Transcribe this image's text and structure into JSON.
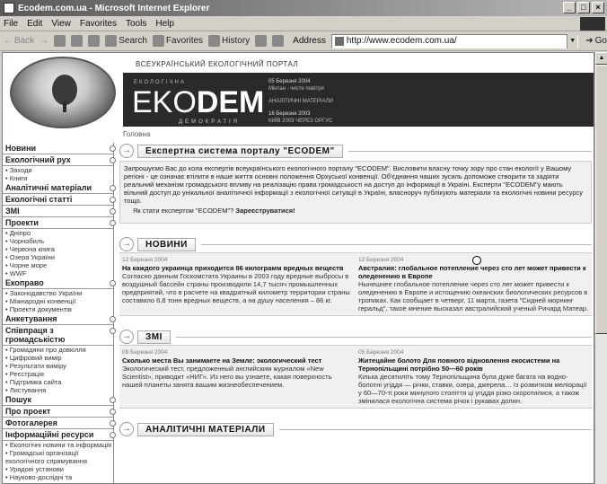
{
  "window": {
    "title": "Ecodem.com.ua - Microsoft Internet Explorer",
    "controls": [
      "_",
      "□",
      "×"
    ]
  },
  "menu": [
    "File",
    "Edit",
    "View",
    "Favorites",
    "Tools",
    "Help"
  ],
  "toolbar": {
    "back": "Back",
    "search": "Search",
    "favorites": "Favorites",
    "history": "History",
    "address_label": "Address",
    "address_value": "http://www.ecodem.com.ua/",
    "go": "Go"
  },
  "header": {
    "portal_title": "ВСЕУКРАЇНСЬКИЙ ЕКОЛОГІЧНИЙ ПОРТАЛ",
    "logo_small": "ЕКОЛОГІЧНА",
    "logo_main_light": "EKO",
    "logo_main_bold": "DEM",
    "logo_sub": "ДЕМОКРАТІЯ",
    "news1_date": "05 Березня 2004",
    "news1_text": "Мінтан - чисте повітря",
    "analytic": "АНАЛІТИЧНІ МАТЕРІАЛИ",
    "news2_date": "16 Березня 2003",
    "news2_text": "КИЇВ 2003 ЧЕРЕЗ ОРГУС"
  },
  "breadcrumb": "Головна",
  "sidebar": [
    {
      "title": "Новини",
      "items": []
    },
    {
      "title": "Екологічний рух",
      "items": [
        "Заходи",
        "Книги"
      ]
    },
    {
      "title": "Аналітичні матеріали",
      "items": []
    },
    {
      "title": "Екологічні статті",
      "items": []
    },
    {
      "title": "ЗМІ",
      "items": []
    },
    {
      "title": "Проекти",
      "items": [
        "Дніпро",
        "Чорнобиль",
        "Червона книга",
        "Озера України",
        "Чорне море",
        "WWF"
      ]
    },
    {
      "title": "Екоправо",
      "items": [
        "Законодавство України",
        "Міжнародні конвенції",
        "Проекти документів"
      ]
    },
    {
      "title": "Анкетування",
      "items": []
    },
    {
      "title": "Співпраця з громадськістю",
      "items": [
        "Громадяни про довкілля",
        "Цифровий вимір",
        "Результати виміру",
        "Реєстрація",
        "Підтримка сайта",
        "Листування"
      ]
    },
    {
      "title": "Пошук",
      "items": []
    },
    {
      "title": "Про проект",
      "items": []
    },
    {
      "title": "Фотогалерея",
      "items": []
    },
    {
      "title": "Інформаційні ресурси",
      "items": [
        "Екологічні новини та інформація",
        "Громадські організації екологічного спрямування",
        "Урядові установи",
        "Науково-дослідні та"
      ]
    }
  ],
  "expert": {
    "heading": "Експертна система порталу \"ECODEM\"",
    "body": "Запрошуємо Вас до кола експертів всеукраїнського екологічного порталу \"ECODEM\". Висловити власну точку зору про стан екології у Вашому регіоні - це означає втілити в наше життя основні положення Орхуської конвенції. Об'єднання наших зусиль допоможе створити та задіяти реальний механізм громадського впливу на реалізацію права громадськості на доступ до інформації в Україні. Експерти \"ECODEM\"у мають вільний доступ до унікальної аналітичної інформації з екологічної ситуації в Україні, власноруч публікують матеріали та екологічні новини ресурсу тощо.",
    "reg_prefix": "Як стати експертом \"ECODEM\"?",
    "reg_link": "Зареєструватися!"
  },
  "news": {
    "heading": "НОВИНИ",
    "left": {
      "date": "12 Березня 2004",
      "title": "На каждого украинца приходится 86 килограмм вредных веществ",
      "body": "Согласно данным Госкомстата Украины в 2003 году вредные выбросы в воздушный бассейн страны производили 14,7 тысяч промышленных предприятий, что в расчете на квадратный километр территории страны составило 6,8 тонн вредных веществ, а на душу населения – 86 кг."
    },
    "right": {
      "date": "12 Березня 2004",
      "title": "Австралия: глобальное потепление через сто лет может привести к оледенению в Европе",
      "body": "Нынешнее глобальное потепление через сто лет может привести к оледенению в Европе и истощению океанских биологических ресурсов в тропиках. Как сообщает в четверг, 11 марта, газета \"Сидней морнинг геральд\", такое мнение высказал австралийский ученый Ричард Матеар."
    }
  },
  "zmi": {
    "heading": "ЗМІ",
    "left": {
      "date": "09 Березня 2004",
      "title": "Сколько места Вы занимаете на Земле: экологический тест",
      "body": "Экологический тест, предложенный английским журналом «New Scientist», приводит «НИГ». Из него вы узнаете, какая поверхность нашей планеты занята вашим жизнеобеспечением."
    },
    "right": {
      "date": "05 Березня 2004",
      "title": "Житецайне болото Для повного відновлення екосистеми на Тернопільщині потрібно 50—60 років",
      "body": "Кілька десятиліть тому Тернопільщина була дуже багата на водно-болотні угіддя — річки, ставки, озера, джерела… Із розвитком меліорації у 60—70-ті роки минулого століття ці угіддя різко скоротилися, а також змінилася екологічна система річок і рукавах долин."
    }
  },
  "analytic": {
    "heading": "АНАЛІТИЧНІ МАТЕРІАЛИ"
  }
}
